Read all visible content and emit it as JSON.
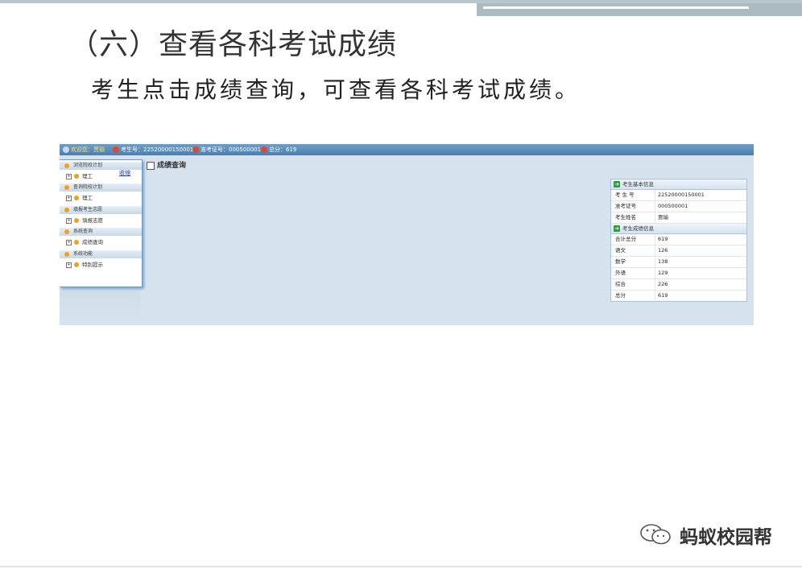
{
  "slide": {
    "title": "（六）查看各科考试成绩",
    "subtitle": "考生点击成绩查询，可查看各科考试成绩。"
  },
  "header": {
    "welcome_label": "欢迎您：",
    "welcome_name": "贾瑜",
    "exam_no": "考生号：22520000150001",
    "ticket_no": "准考证号：000500001",
    "total": "总分：619"
  },
  "sidebar": {
    "collapse_label": "收缩",
    "groups": [
      {
        "title": "浏览院校计划",
        "item": "理工"
      },
      {
        "title": "查询院校计划",
        "item": "理工"
      },
      {
        "title": "填报考生志愿",
        "item": "填报志愿"
      },
      {
        "title": "系统查询",
        "item": "成绩查询"
      },
      {
        "title": "系统功能",
        "item": "特别提示"
      }
    ]
  },
  "main": {
    "heading": "成绩查询"
  },
  "info_panel": {
    "title": "考生基本信息",
    "rows": [
      {
        "k": "考 生 号",
        "v": "22520000150001"
      },
      {
        "k": "准考证号",
        "v": "000500001"
      },
      {
        "k": "考生姓名",
        "v": "贾瑜"
      }
    ]
  },
  "score_panel": {
    "title": "考生成绩信息",
    "rows": [
      {
        "k": "合计总分",
        "v": "619"
      },
      {
        "k": "语文",
        "v": "126"
      },
      {
        "k": "数学",
        "v": "138"
      },
      {
        "k": "外语",
        "v": "129"
      },
      {
        "k": "综合",
        "v": "226"
      },
      {
        "k": "总分",
        "v": "619"
      }
    ]
  },
  "watermark": {
    "text": "蚂蚁校园帮",
    "icon": "wechat-icon"
  }
}
